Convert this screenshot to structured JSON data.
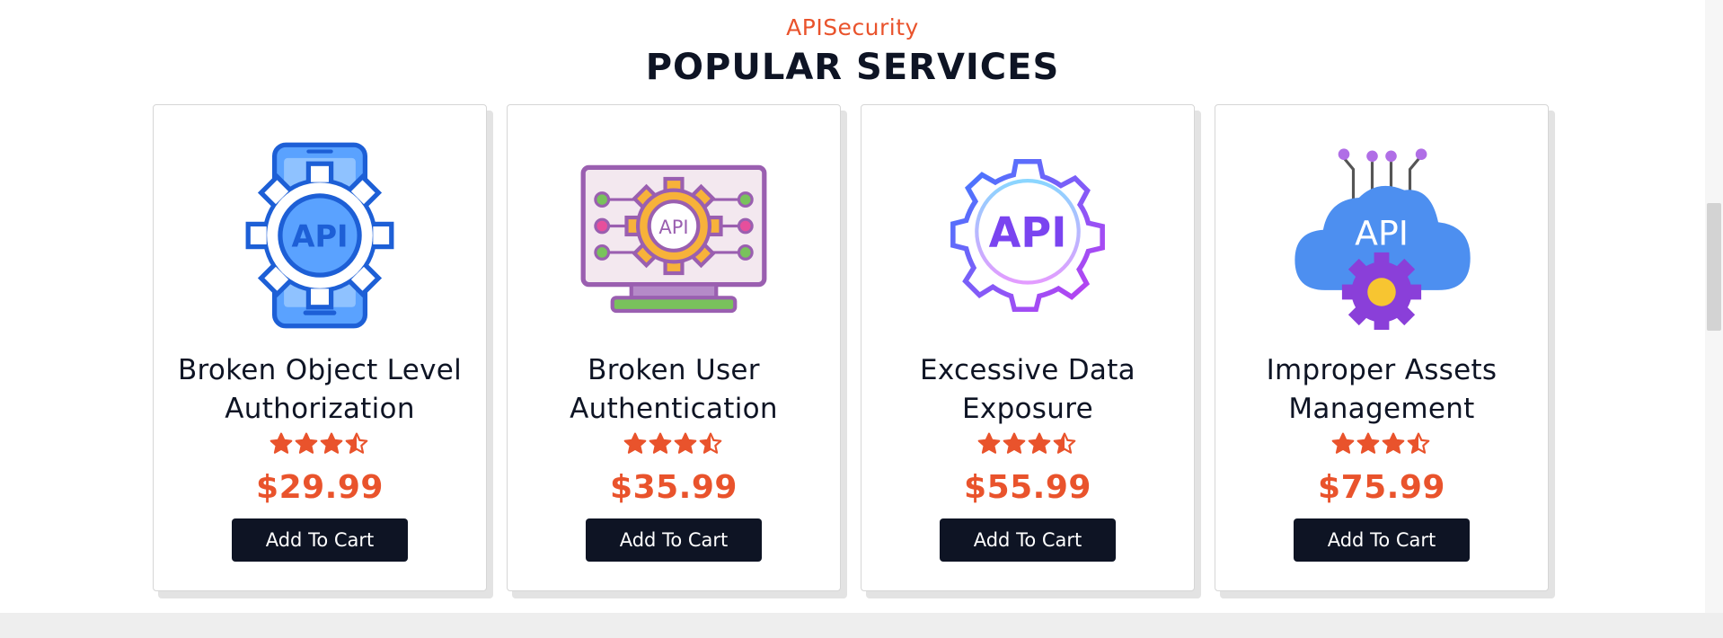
{
  "section": {
    "subtitle": "APISecurity",
    "title": "POPULAR SERVICES"
  },
  "products": [
    {
      "name": "Broken Object Level Authorization",
      "price": "$29.99",
      "rating": 3.5,
      "button_label": "Add To Cart",
      "icon": "api-phone-gear-icon"
    },
    {
      "name": "Broken User Authentication",
      "price": "$35.99",
      "rating": 3.5,
      "button_label": "Add To Cart",
      "icon": "api-monitor-gear-icon"
    },
    {
      "name": "Excessive Data Exposure",
      "price": "$55.99",
      "rating": 3.5,
      "button_label": "Add To Cart",
      "icon": "api-gear-icon"
    },
    {
      "name": "Improper Assets Management",
      "price": "$75.99",
      "rating": 3.5,
      "button_label": "Add To Cart",
      "icon": "api-cloud-icon"
    }
  ],
  "colors": {
    "accent": "#e9532c",
    "dark": "#0e1424",
    "page_background": "#ffffff"
  }
}
